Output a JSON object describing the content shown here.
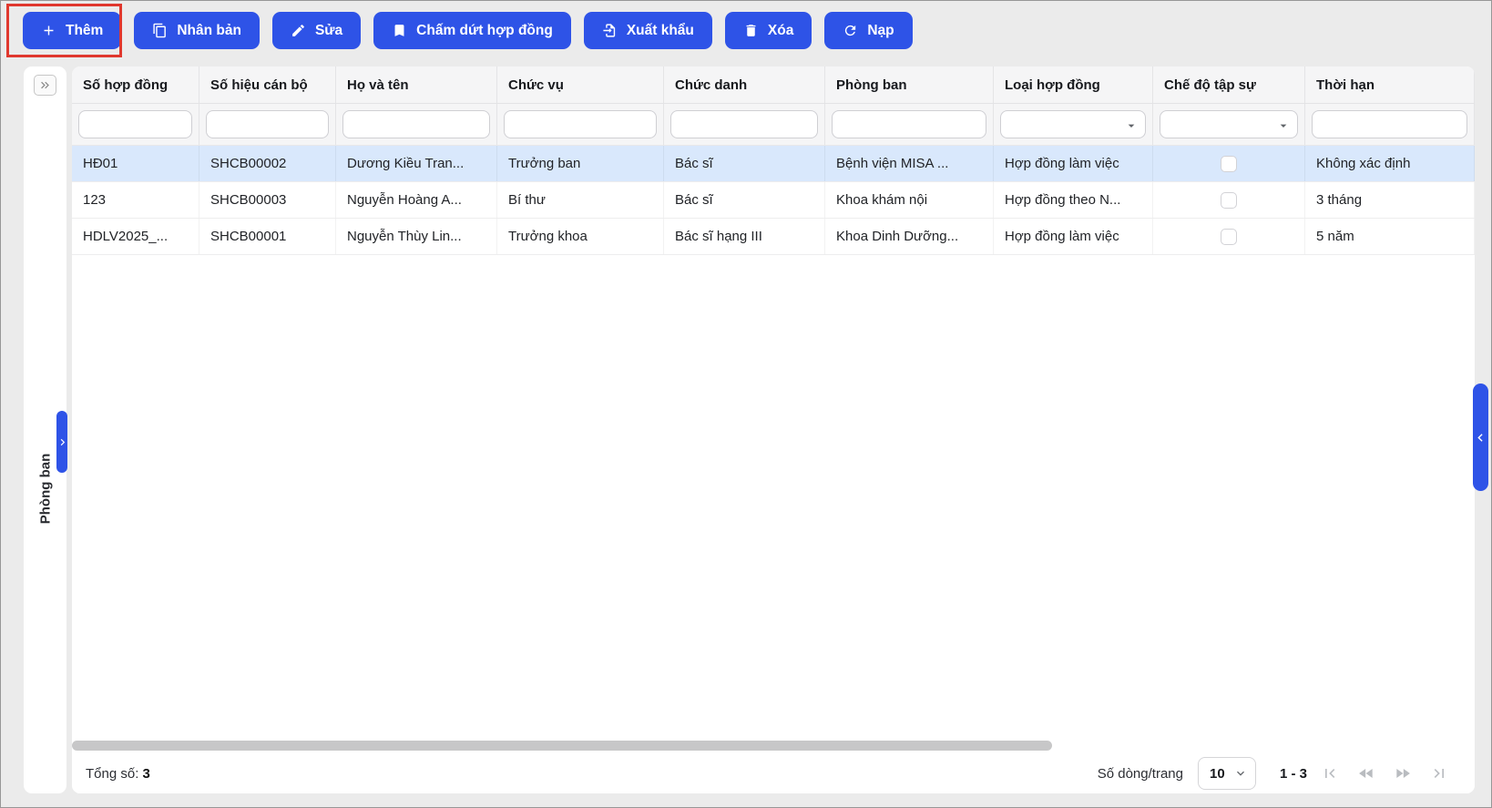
{
  "colors": {
    "accent": "#2e53e7",
    "annotation_red": "#e0382e",
    "selected_row": "#d9e8fc"
  },
  "toolbar": {
    "buttons": [
      {
        "label": "Thêm",
        "icon": "plus-icon",
        "highlighted": true
      },
      {
        "label": "Nhân bản",
        "icon": "duplicate-icon"
      },
      {
        "label": "Sửa",
        "icon": "pencil-icon"
      },
      {
        "label": "Chấm dứt hợp đồng",
        "icon": "bookmark-icon"
      },
      {
        "label": "Xuất khẩu",
        "icon": "export-icon"
      },
      {
        "label": "Xóa",
        "icon": "trash-icon"
      },
      {
        "label": "Nạp",
        "icon": "refresh-icon"
      }
    ]
  },
  "sidebar": {
    "panel_label": "Phòng ban"
  },
  "table": {
    "columns": [
      "Số hợp đồng",
      "Số hiệu cán bộ",
      "Họ và tên",
      "Chức vụ",
      "Chức danh",
      "Phòng ban",
      "Loại hợp đồng",
      "Chế độ tập sự",
      "Thời hạn"
    ],
    "filters": [
      "text",
      "text",
      "text",
      "text",
      "text",
      "text",
      "select",
      "select",
      "text"
    ],
    "rows": [
      {
        "selected": true,
        "checkbox_checked": false,
        "cells": [
          "HĐ01",
          "SHCB00002",
          "Dương Kiều Tran...",
          "Trưởng ban",
          "Bác sĩ",
          "Bệnh viện MISA ...",
          "Hợp đồng làm việc",
          null,
          "Không xác định"
        ]
      },
      {
        "selected": false,
        "checkbox_checked": false,
        "cells": [
          "123",
          "SHCB00003",
          "Nguyễn Hoàng A...",
          "Bí thư",
          "Bác sĩ",
          "Khoa khám nội",
          "Hợp đồng theo N...",
          null,
          "3 tháng"
        ]
      },
      {
        "selected": false,
        "checkbox_checked": false,
        "cells": [
          "HDLV2025_...",
          "SHCB00001",
          "Nguyễn Thùy Lin...",
          "Trưởng khoa",
          "Bác sĩ hạng III",
          "Khoa Dinh Dưỡng...",
          "Hợp đồng làm việc",
          null,
          "5 năm"
        ]
      }
    ]
  },
  "footer": {
    "total_label": "Tổng số:",
    "total_value": "3",
    "rows_per_page_label": "Số dòng/trang",
    "rows_per_page_value": "10",
    "range": "1 - 3"
  }
}
